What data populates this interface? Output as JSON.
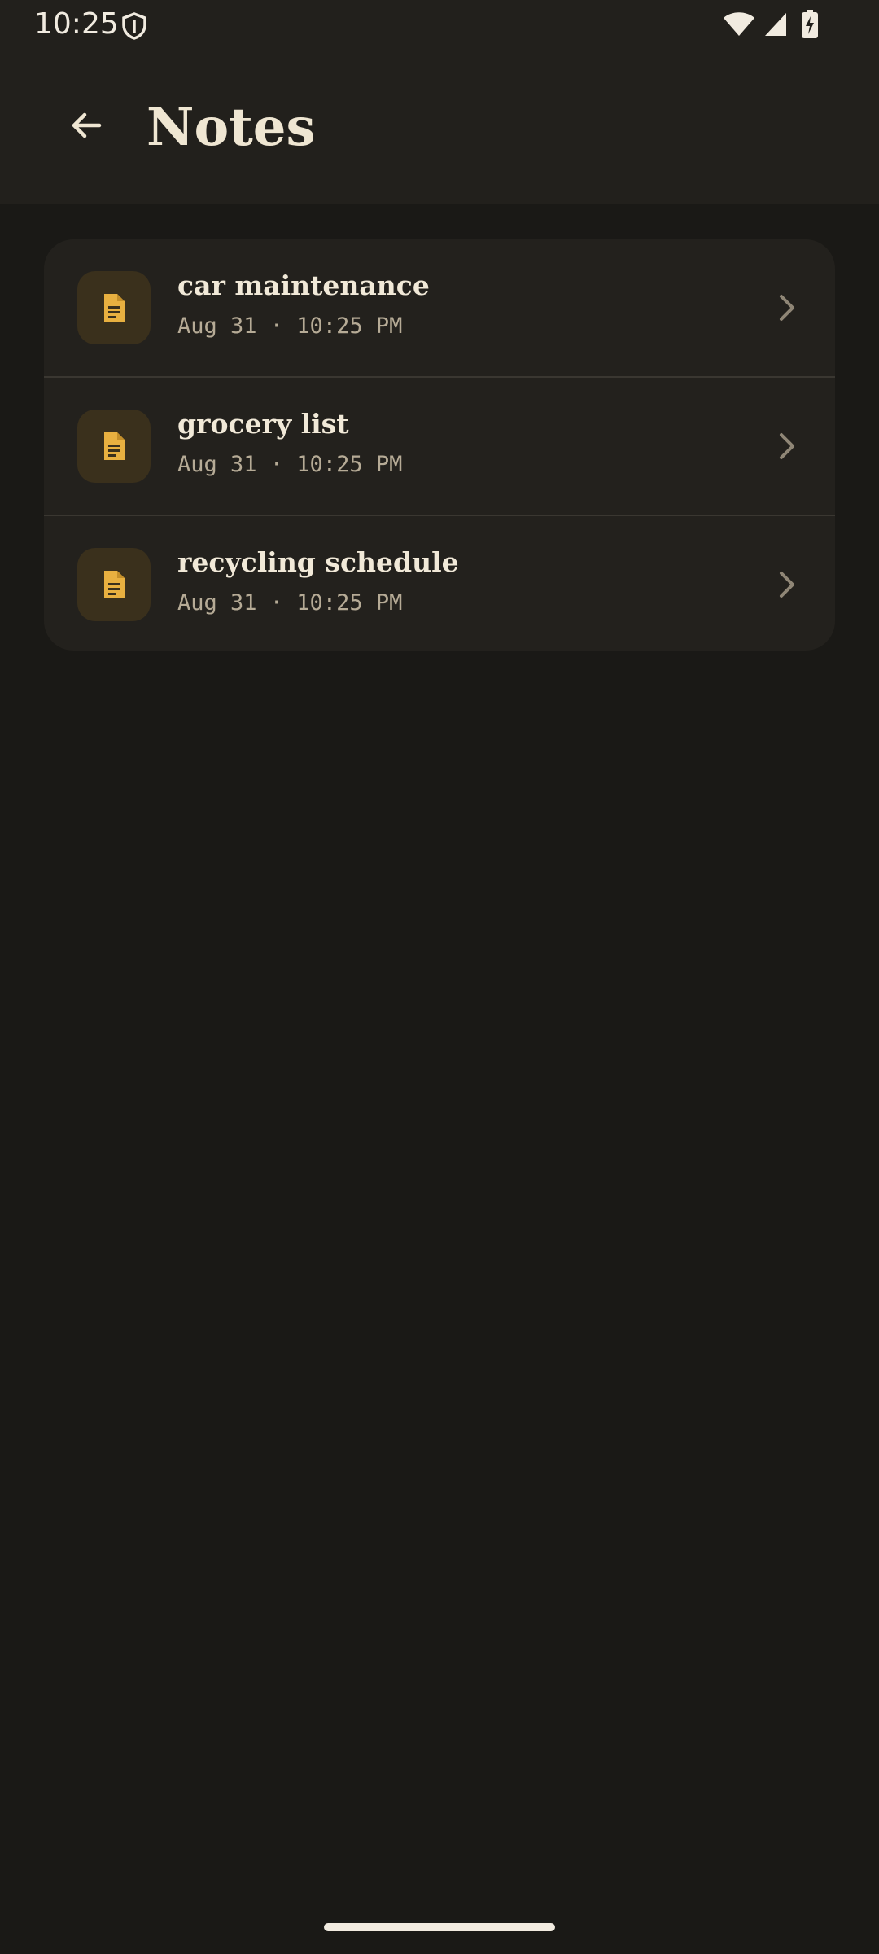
{
  "status_bar": {
    "time": "10:25",
    "icons": [
      "shield-icon",
      "wifi-icon",
      "signal-icon",
      "battery-charging-icon"
    ]
  },
  "app_bar": {
    "back_icon": "arrow-back-icon",
    "title": "Notes"
  },
  "notes": [
    {
      "title": "car maintenance",
      "meta": "Aug 31 · 10:25 PM",
      "icon": "document-icon"
    },
    {
      "title": "grocery list",
      "meta": "Aug 31 · 10:25 PM",
      "icon": "document-icon"
    },
    {
      "title": "recycling schedule",
      "meta": "Aug 31 · 10:25 PM",
      "icon": "document-icon"
    }
  ],
  "colors": {
    "background": "#1a1916",
    "app_bar": "#22201c",
    "card": "#23211d",
    "accent": "#e8b040",
    "icon_box": "#3a301c",
    "title_text": "#efe6d2",
    "meta_text": "#b6ab96"
  }
}
